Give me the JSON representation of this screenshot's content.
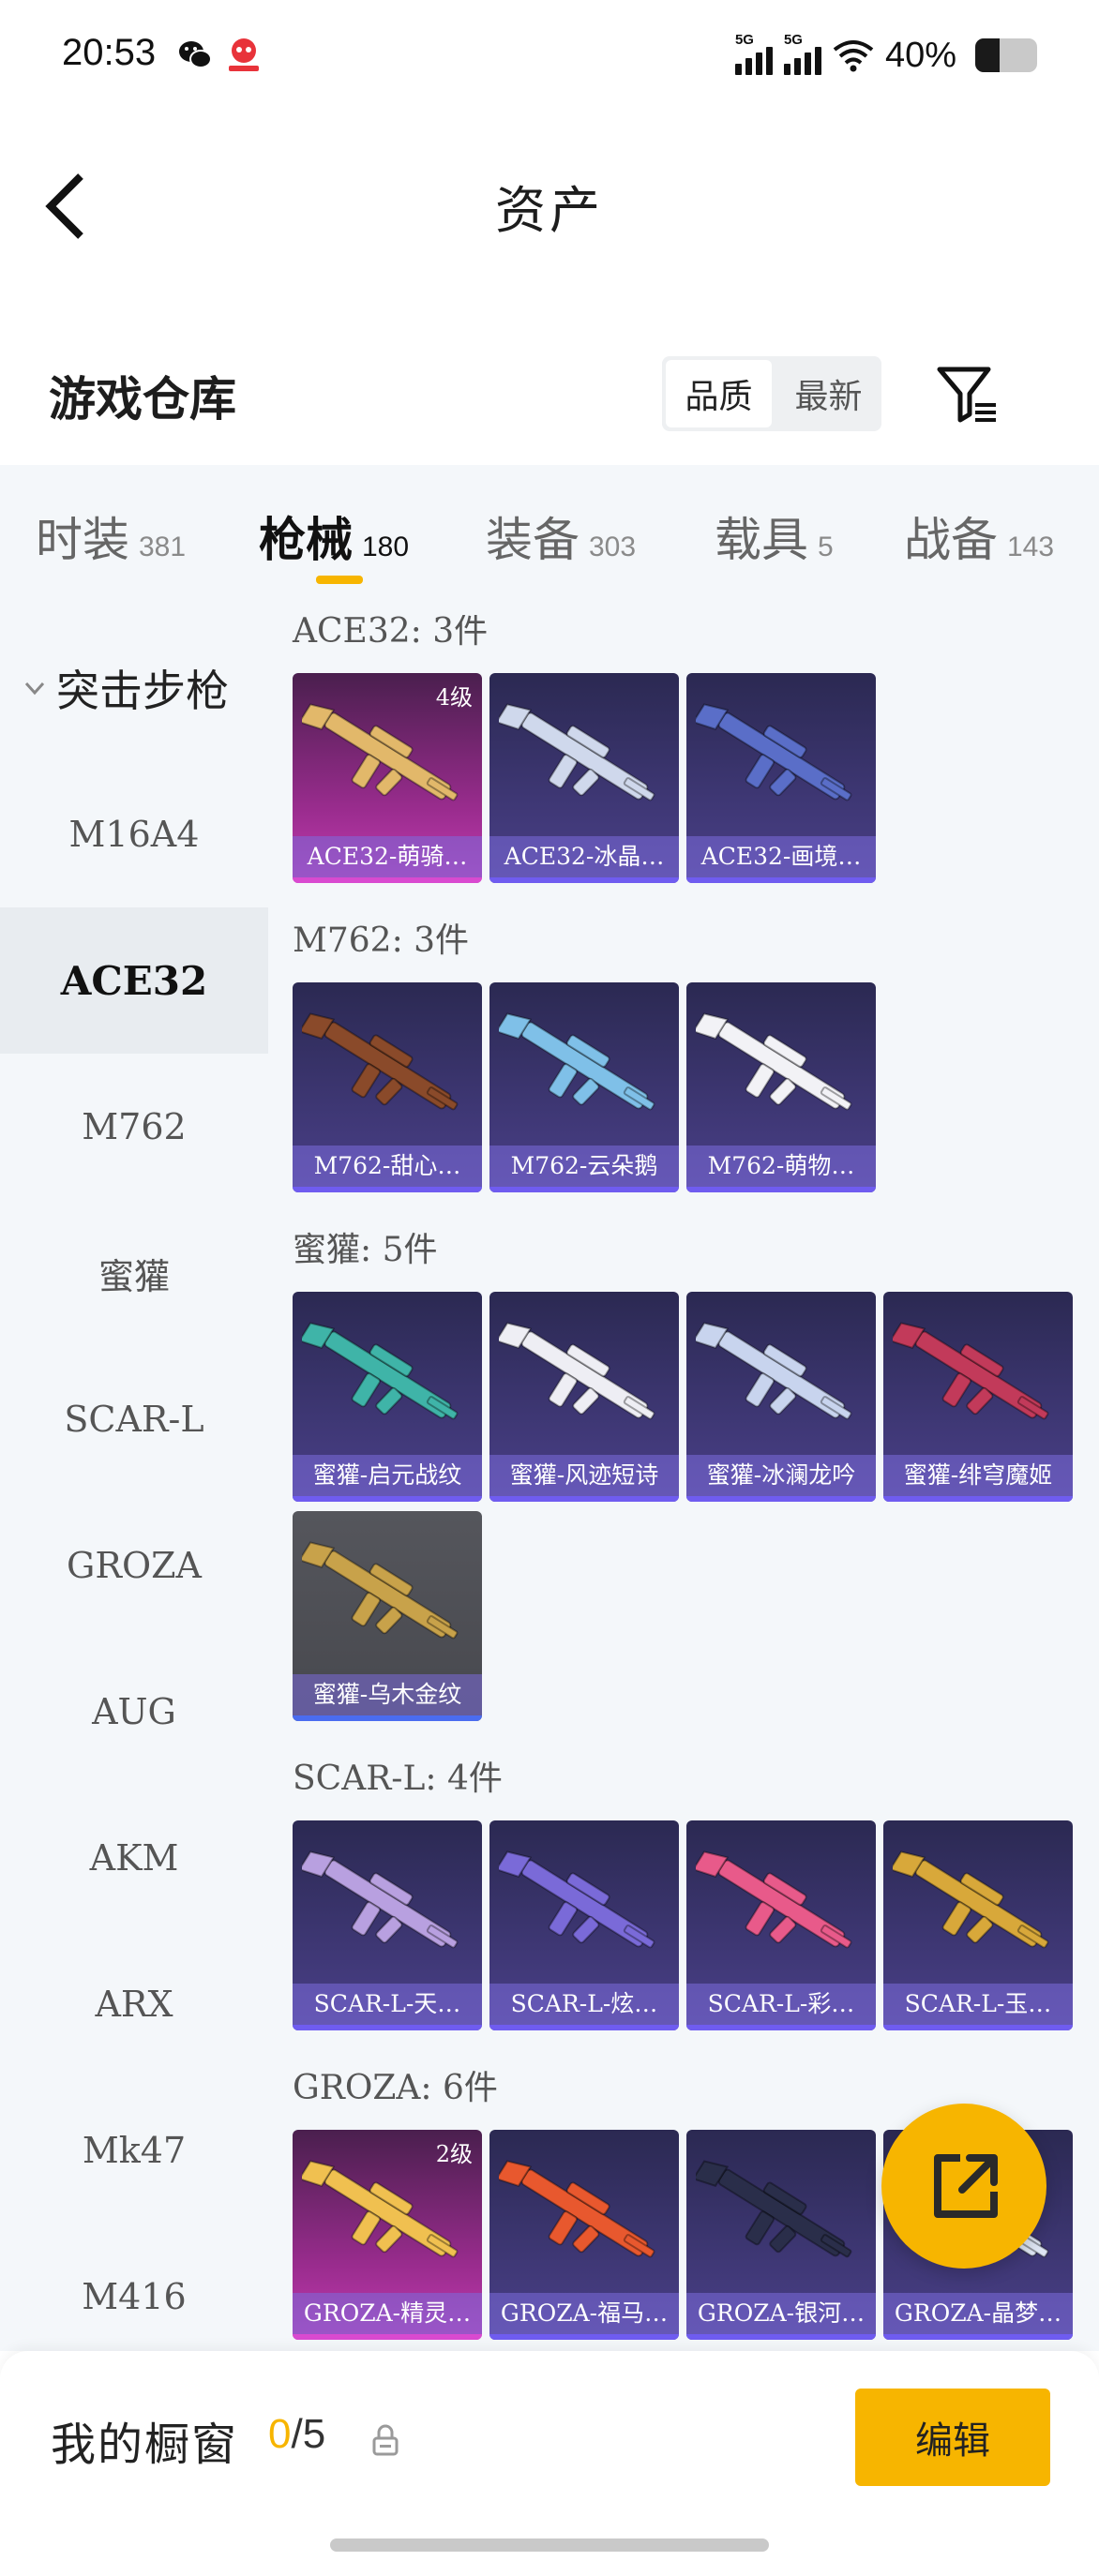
{
  "status_bar": {
    "time": "20:53",
    "signal1_tag": "5G",
    "signal2_tag": "5G",
    "battery_text": "40%",
    "battery_level": 0.4
  },
  "header": {
    "title": "资产"
  },
  "warehouse": {
    "title": "游戏仓库",
    "sort_options": [
      "品质",
      "最新"
    ],
    "sort_active": "品质"
  },
  "tabs": [
    {
      "label": "时装",
      "count": "381"
    },
    {
      "label": "枪械",
      "count": "180"
    },
    {
      "label": "装备",
      "count": "303"
    },
    {
      "label": "载具",
      "count": "5"
    },
    {
      "label": "战备",
      "count": "143"
    }
  ],
  "active_tab": "枪械",
  "sidebar": {
    "group_label": "突击步枪",
    "items": [
      "M16A4",
      "ACE32",
      "M762",
      "蜜獾",
      "SCAR-L",
      "GROZA",
      "AUG",
      "AKM",
      "ARX",
      "Mk47",
      "M416"
    ],
    "active_item": "ACE32"
  },
  "groups": [
    {
      "title": "ACE32: 3件",
      "items": [
        {
          "label": "ACE32-萌骑…",
          "level": "4级",
          "rarity": "gold"
        },
        {
          "label": "ACE32-冰晶…",
          "rarity": "purple"
        },
        {
          "label": "ACE32-画境…",
          "rarity": "purple"
        }
      ]
    },
    {
      "title": "M762: 3件",
      "items": [
        {
          "label": "M762-甜心…",
          "rarity": "purple"
        },
        {
          "label": "M762-云朵鹅",
          "rarity": "purple"
        },
        {
          "label": "M762-萌物…",
          "rarity": "purple"
        }
      ]
    },
    {
      "title": "蜜獾: 5件",
      "items": [
        {
          "label": "蜜獾-启元战纹",
          "rarity": "purple"
        },
        {
          "label": "蜜獾-风迹短诗",
          "rarity": "purple"
        },
        {
          "label": "蜜獾-冰澜龙吟",
          "rarity": "purple"
        },
        {
          "label": "蜜獾-绯穹魔姬",
          "rarity": "purple"
        },
        {
          "label": "蜜獾-乌木金纹",
          "rarity": "grey"
        }
      ]
    },
    {
      "title": "SCAR-L: 4件",
      "items": [
        {
          "label": "SCAR-L-天…",
          "rarity": "purple"
        },
        {
          "label": "SCAR-L-炫…",
          "rarity": "purple"
        },
        {
          "label": "SCAR-L-彩…",
          "rarity": "purple"
        },
        {
          "label": "SCAR-L-玉…",
          "rarity": "purple"
        }
      ]
    },
    {
      "title": "GROZA: 6件",
      "items": [
        {
          "label": "GROZA-精灵…",
          "level": "2级",
          "rarity": "gold"
        },
        {
          "label": "GROZA-福马…",
          "rarity": "purple"
        },
        {
          "label": "GROZA-银河…",
          "rarity": "purple"
        },
        {
          "label": "GROZA-晶梦…",
          "rarity": "purple"
        }
      ]
    }
  ],
  "bottom": {
    "showcase_title": "我的橱窗",
    "current": "0",
    "total": "/5",
    "edit_label": "编辑"
  },
  "icons": {
    "back": "back-arrow-icon",
    "filter": "filter-icon",
    "share": "share-external-icon",
    "lock": "lock-icon",
    "chevron": "chevron-down-icon"
  },
  "colors": {
    "accent": "#f7b500",
    "card_purple": "#3e3774",
    "card_gold": "#c23bb0",
    "card_grey": "#47484e"
  }
}
